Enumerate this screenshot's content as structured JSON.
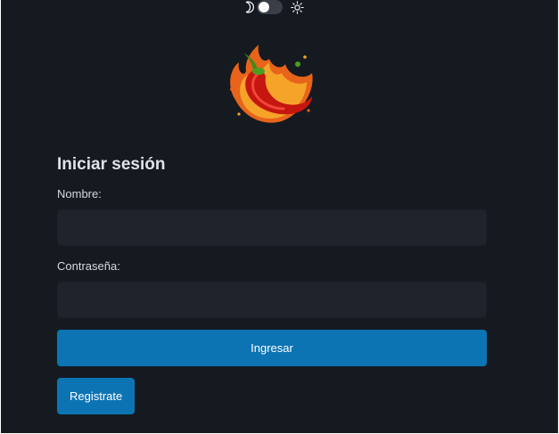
{
  "theme_toggle": {
    "left_icon": "moon-icon",
    "right_icon": "sun-icon"
  },
  "logo": {
    "icon": "chili-pepper-logo"
  },
  "login": {
    "title": "Iniciar sesión",
    "name_label": "Nombre:",
    "name_value": "",
    "password_label": "Contraseña:",
    "password_value": "",
    "submit_label": "Ingresar",
    "register_label": "Registrate"
  },
  "colors": {
    "background": "#151a21",
    "input_background": "#1f232c",
    "primary_button": "#0d74b4"
  }
}
